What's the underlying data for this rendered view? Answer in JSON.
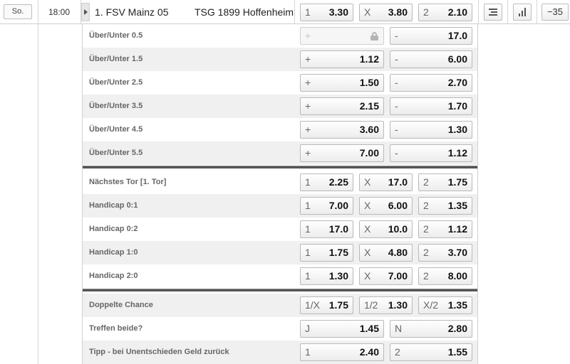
{
  "header": {
    "day": "So.",
    "time": "18:00",
    "home_team": "1. FSV Mainz 05",
    "away_team": "TSG 1899 Hoffenheim",
    "odds": [
      {
        "key": "1",
        "value": "3.30"
      },
      {
        "key": "X",
        "value": "3.80"
      },
      {
        "key": "2",
        "value": "2.10"
      }
    ],
    "more_label": "−35"
  },
  "markets": [
    {
      "label": "Über/Unter 0.5",
      "odds": [
        {
          "key": "+",
          "value": "",
          "locked": true
        },
        {
          "key": "-",
          "value": "17.0"
        }
      ]
    },
    {
      "label": "Über/Unter 1.5",
      "odds": [
        {
          "key": "+",
          "value": "1.12"
        },
        {
          "key": "-",
          "value": "6.00"
        }
      ]
    },
    {
      "label": "Über/Unter 2.5",
      "odds": [
        {
          "key": "+",
          "value": "1.50"
        },
        {
          "key": "-",
          "value": "2.70"
        }
      ]
    },
    {
      "label": "Über/Unter 3.5",
      "odds": [
        {
          "key": "+",
          "value": "2.15"
        },
        {
          "key": "-",
          "value": "1.70"
        }
      ]
    },
    {
      "label": "Über/Unter 4.5",
      "odds": [
        {
          "key": "+",
          "value": "3.60"
        },
        {
          "key": "-",
          "value": "1.30"
        }
      ]
    },
    {
      "label": "Über/Unter 5.5",
      "odds": [
        {
          "key": "+",
          "value": "7.00"
        },
        {
          "key": "-",
          "value": "1.12"
        }
      ]
    },
    {
      "label": "Nächstes Tor  [1. Tor]",
      "odds": [
        {
          "key": "1",
          "value": "2.25"
        },
        {
          "key": "X",
          "value": "17.0"
        },
        {
          "key": "2",
          "value": "1.75"
        }
      ]
    },
    {
      "label": "Handicap 0:1",
      "odds": [
        {
          "key": "1",
          "value": "7.00"
        },
        {
          "key": "X",
          "value": "6.00"
        },
        {
          "key": "2",
          "value": "1.35"
        }
      ]
    },
    {
      "label": "Handicap 0:2",
      "odds": [
        {
          "key": "1",
          "value": "17.0"
        },
        {
          "key": "X",
          "value": "10.0"
        },
        {
          "key": "2",
          "value": "1.12"
        }
      ]
    },
    {
      "label": "Handicap 1:0",
      "odds": [
        {
          "key": "1",
          "value": "1.75"
        },
        {
          "key": "X",
          "value": "4.80"
        },
        {
          "key": "2",
          "value": "3.70"
        }
      ]
    },
    {
      "label": "Handicap 2:0",
      "odds": [
        {
          "key": "1",
          "value": "1.30"
        },
        {
          "key": "X",
          "value": "7.00"
        },
        {
          "key": "2",
          "value": "8.00"
        }
      ]
    },
    {
      "label": "Doppelte Chance",
      "odds": [
        {
          "key": "1/X",
          "value": "1.75"
        },
        {
          "key": "1/2",
          "value": "1.30"
        },
        {
          "key": "X/2",
          "value": "1.35"
        }
      ]
    },
    {
      "label": "Treffen beide?",
      "odds": [
        {
          "key": "J",
          "value": "1.45"
        },
        {
          "key": "N",
          "value": "2.80"
        }
      ]
    },
    {
      "label": "Tipp - bei Unentschieden Geld zurück",
      "odds": [
        {
          "key": "1",
          "value": "2.40"
        },
        {
          "key": "2",
          "value": "1.55"
        }
      ]
    }
  ]
}
